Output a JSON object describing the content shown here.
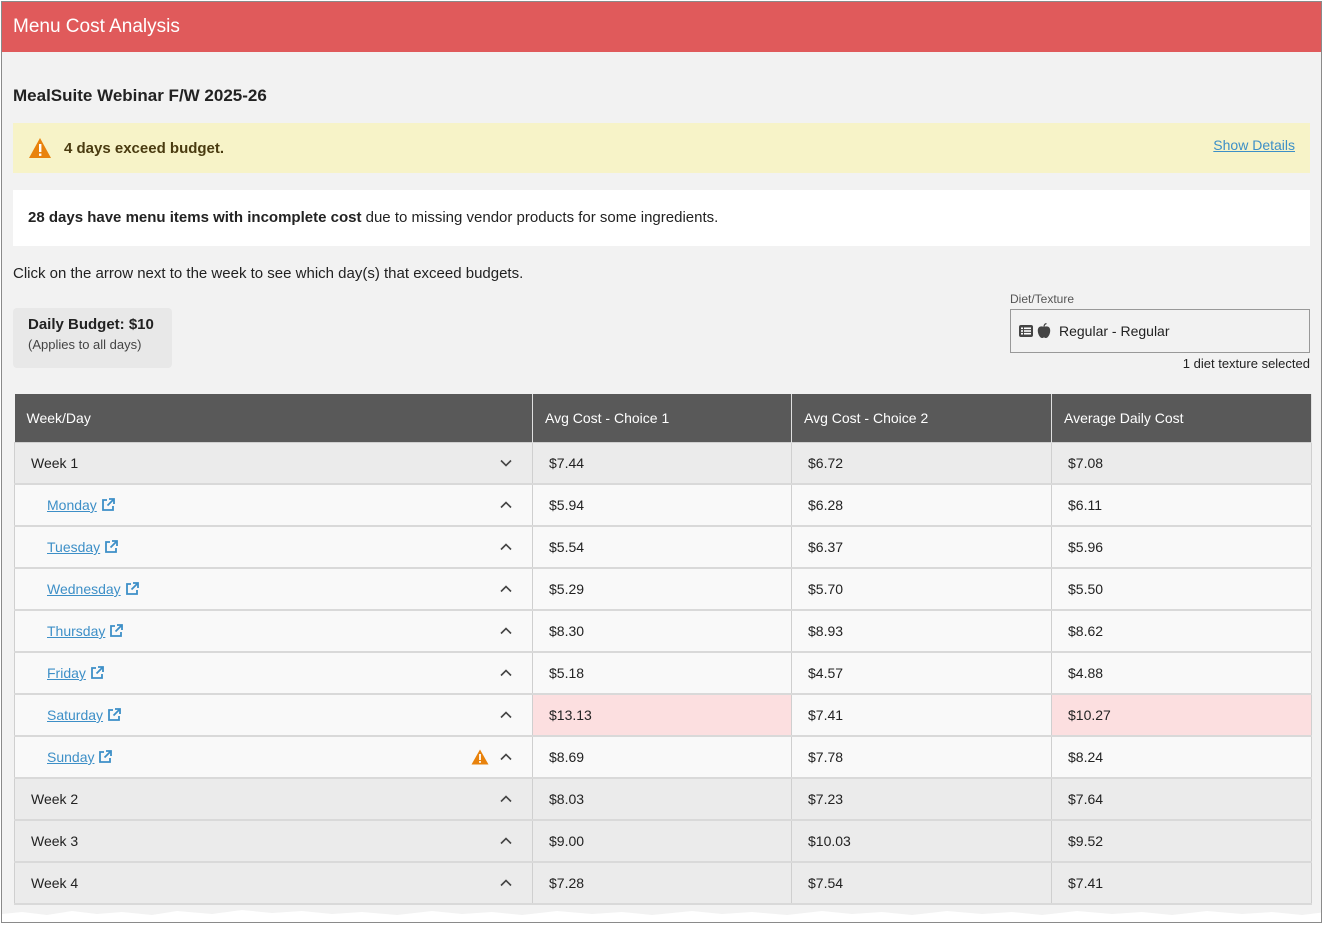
{
  "header": {
    "title": "Menu Cost Analysis"
  },
  "menu": {
    "name": "MealSuite Webinar F/W 2025-26"
  },
  "alert": {
    "message": "4 days exceed budget.",
    "details_link": "Show Details"
  },
  "notice": {
    "bold": "28 days have menu items with incomplete cost",
    "rest": " due to missing vendor products for some ingredients."
  },
  "instructions": "Click on the arrow next to the week to see which day(s) that exceed budgets.",
  "budget": {
    "title": "Daily Budget: $10",
    "subtitle": "(Applies to all days)"
  },
  "diet": {
    "label": "Diet/Texture",
    "value": "Regular - Regular",
    "count": "1 diet texture selected",
    "icons": [
      "list-icon",
      "apple-icon"
    ]
  },
  "colors": {
    "header_bg": "#e05a5b",
    "alert_bg": "#f7f3c8",
    "over_budget_bg": "#fcdfe0",
    "link": "#3d8fc7",
    "warning": "#e8820c",
    "table_header_bg": "#595959"
  },
  "table": {
    "columns": [
      "Week/Day",
      "Avg Cost - Choice 1",
      "Avg Cost - Choice 2",
      "Average Daily Cost"
    ],
    "rows": [
      {
        "type": "week",
        "name": "Week 1",
        "chevron": "down",
        "c1": "$7.44",
        "c2": "$6.72",
        "avg": "$7.08"
      },
      {
        "type": "day",
        "name": "Monday",
        "chevron": "up",
        "c1": "$5.94",
        "c2": "$6.28",
        "avg": "$6.11"
      },
      {
        "type": "day",
        "name": "Tuesday",
        "chevron": "up",
        "c1": "$5.54",
        "c2": "$6.37",
        "avg": "$5.96"
      },
      {
        "type": "day",
        "name": "Wednesday",
        "chevron": "up",
        "c1": "$5.29",
        "c2": "$5.70",
        "avg": "$5.50"
      },
      {
        "type": "day",
        "name": "Thursday",
        "chevron": "up",
        "c1": "$8.30",
        "c2": "$8.93",
        "avg": "$8.62"
      },
      {
        "type": "day",
        "name": "Friday",
        "chevron": "up",
        "c1": "$5.18",
        "c2": "$4.57",
        "avg": "$4.88"
      },
      {
        "type": "day",
        "name": "Saturday",
        "chevron": "up",
        "c1": "$13.13",
        "c2": "$7.41",
        "avg": "$10.27",
        "over": [
          "c1",
          "avg"
        ]
      },
      {
        "type": "day",
        "name": "Sunday",
        "chevron": "up",
        "warning": true,
        "c1": "$8.69",
        "c2": "$7.78",
        "avg": "$8.24"
      },
      {
        "type": "week",
        "name": "Week 2",
        "chevron": "up",
        "c1": "$8.03",
        "c2": "$7.23",
        "avg": "$7.64"
      },
      {
        "type": "week",
        "name": "Week 3",
        "chevron": "up",
        "c1": "$9.00",
        "c2": "$10.03",
        "avg": "$9.52"
      },
      {
        "type": "week",
        "name": "Week 4",
        "chevron": "up",
        "c1": "$7.28",
        "c2": "$7.54",
        "avg": "$7.41"
      }
    ]
  }
}
